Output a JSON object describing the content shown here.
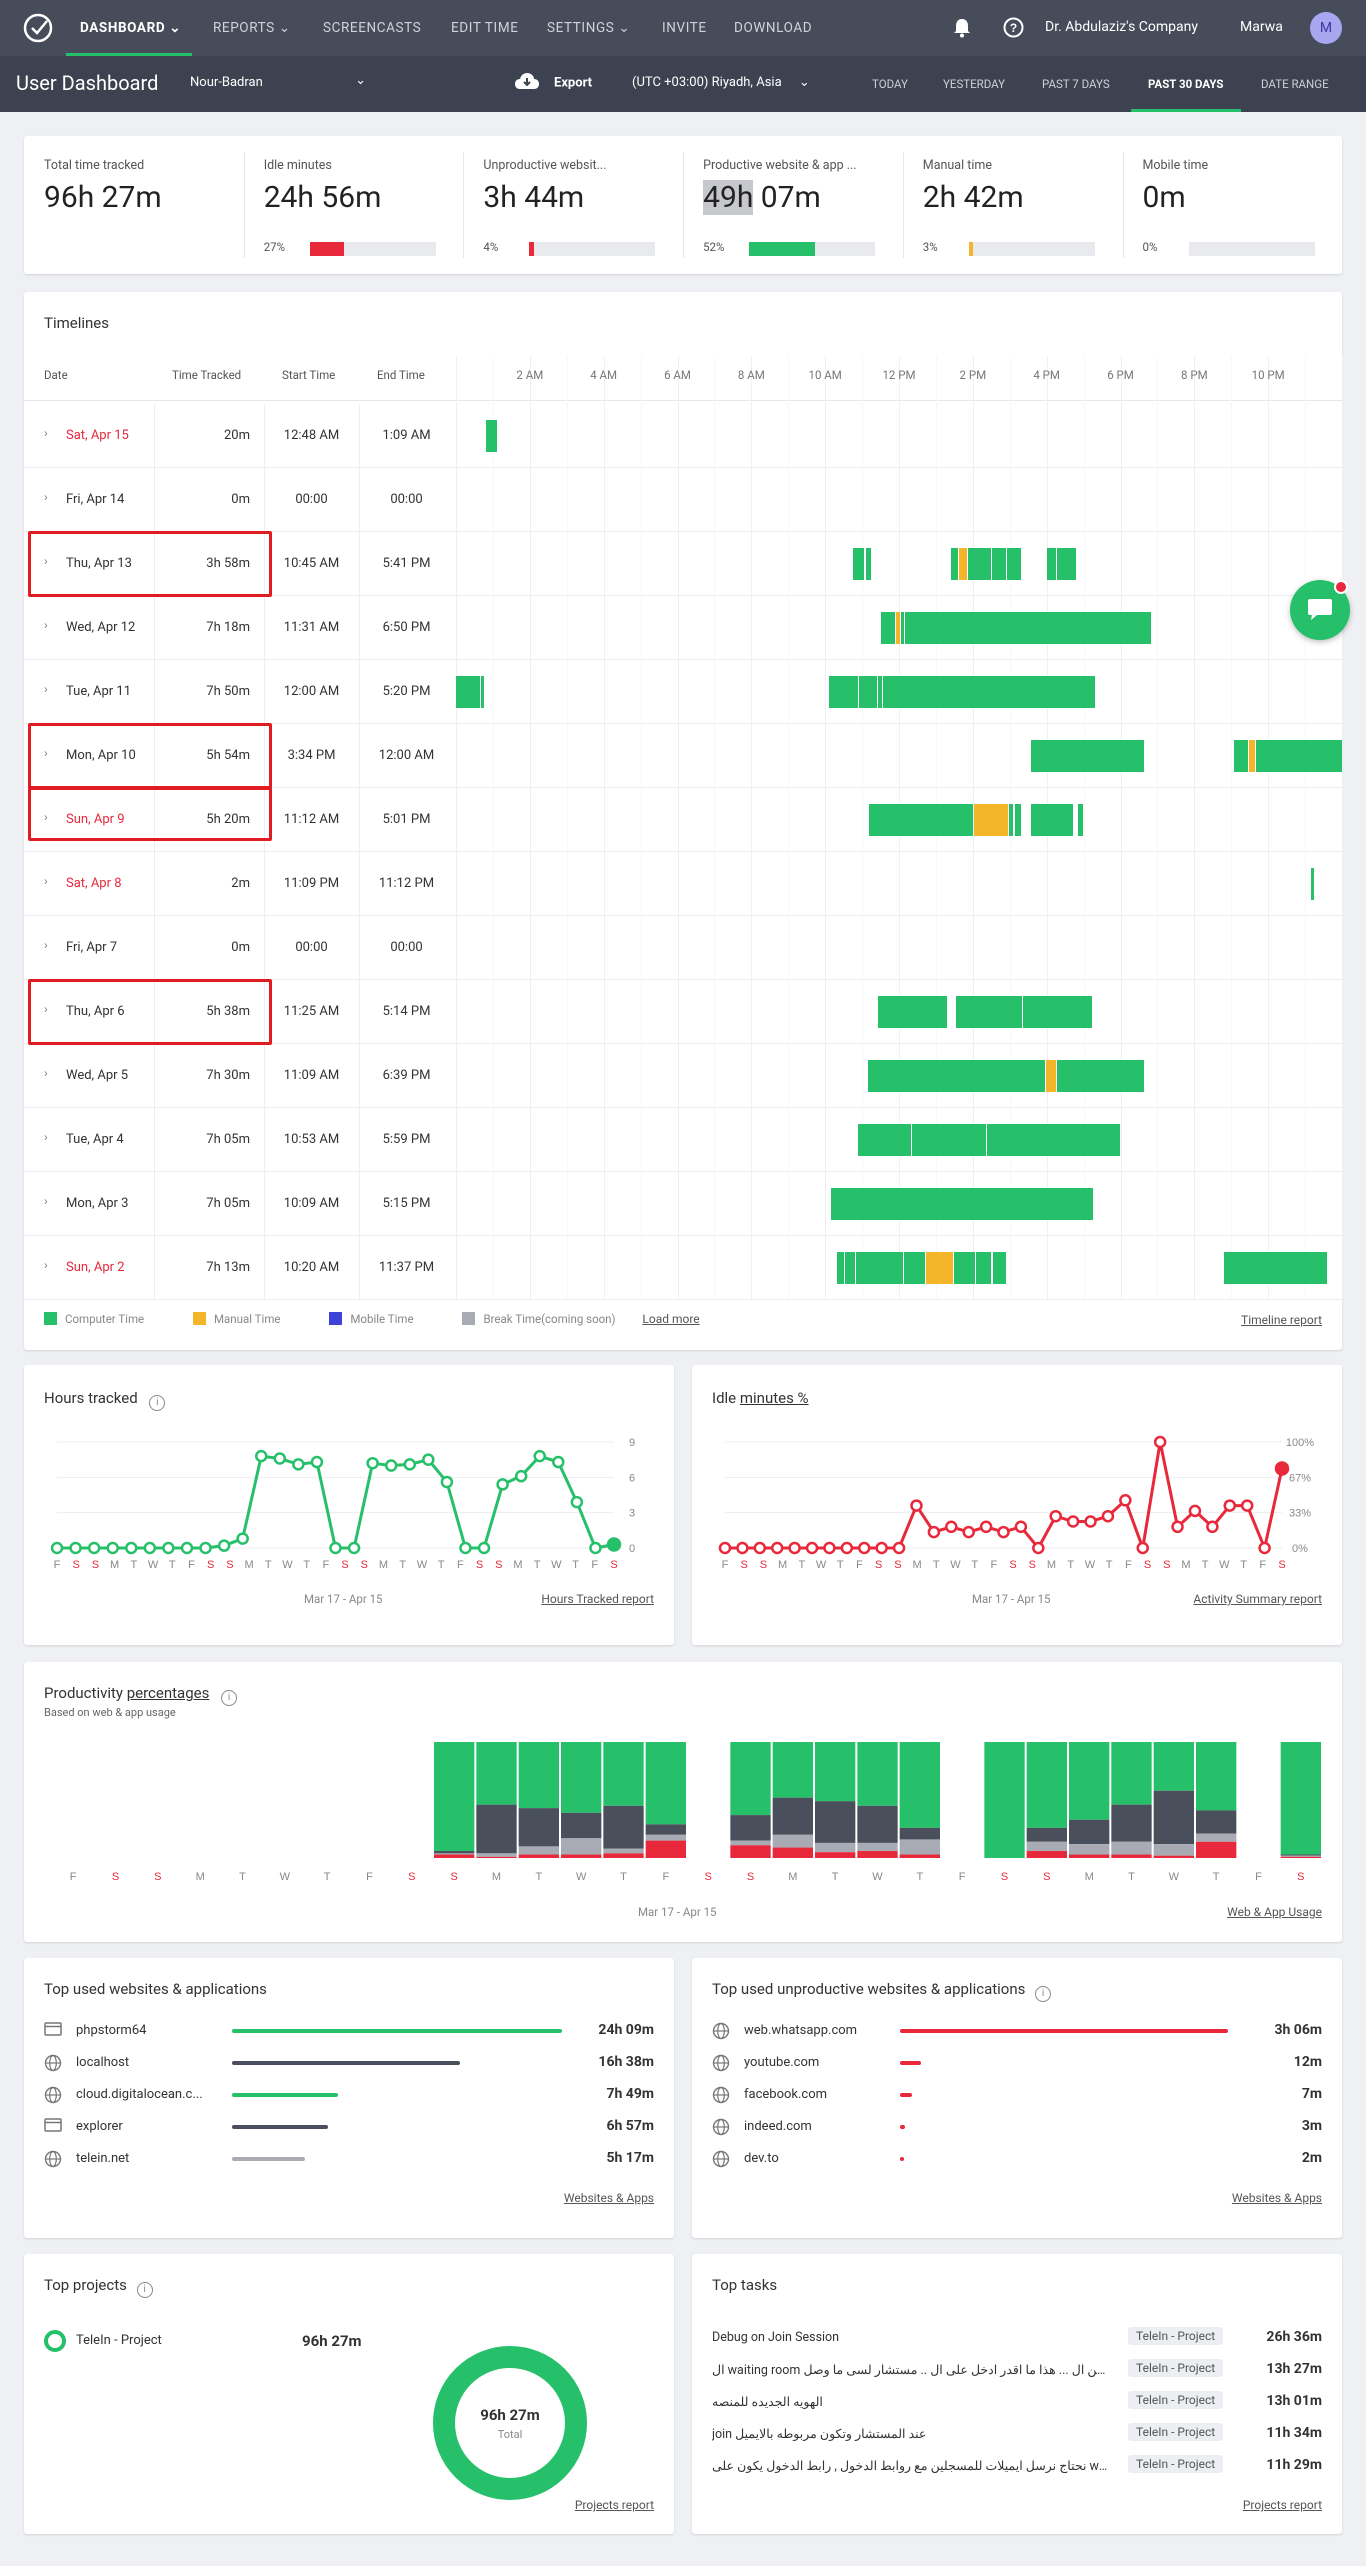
{
  "nav": {
    "dashboard": "DASHBOARD",
    "reports": "REPORTS",
    "screencasts": "SCREENCASTS",
    "edit_time": "EDIT TIME",
    "settings": "SETTINGS",
    "invite": "INVITE",
    "download": "DOWNLOAD",
    "company": "Dr. Abdulaziz's Company",
    "user": "Marwa",
    "avatar_initial": "M"
  },
  "header": {
    "title": "User Dashboard",
    "selected_user": "Nour-Badran",
    "export": "Export",
    "timezone": "(UTC +03:00) Riyadh, Asia",
    "ranges": [
      "TODAY",
      "YESTERDAY",
      "PAST 7 DAYS",
      "PAST 30 DAYS",
      "DATE RANGE"
    ],
    "active_range": "PAST 30 DAYS"
  },
  "stats": [
    {
      "label": "Total time tracked",
      "value": "96h 27m"
    },
    {
      "label": "Idle minutes",
      "value": "24h 56m",
      "pct": "27%",
      "fill": 0.27,
      "color": "#e8283b"
    },
    {
      "label": "Unproductive websit...",
      "value": "3h 44m",
      "pct": "4%",
      "fill": 0.04,
      "color": "#e8283b"
    },
    {
      "label": "Productive website & app ...",
      "value_hl": "49h",
      "value_rest": " 07m",
      "pct": "52%",
      "fill": 0.52,
      "color": "#27c06a"
    },
    {
      "label": "Manual time",
      "value": "2h 42m",
      "pct": "3%",
      "fill": 0.03,
      "color": "#f5b52a"
    },
    {
      "label": "Mobile time",
      "value": "0m",
      "pct": "0%",
      "fill": 0,
      "color": "#27c06a"
    }
  ],
  "timelines": {
    "title": "Timelines",
    "headers": {
      "date": "Date",
      "tracked": "Time Tracked",
      "start": "Start Time",
      "end": "End Time"
    },
    "hours": [
      "2 AM",
      "4 AM",
      "6 AM",
      "8 AM",
      "10 AM",
      "12 PM",
      "2 PM",
      "4 PM",
      "6 PM",
      "8 PM",
      "10 PM"
    ],
    "rows": [
      {
        "date": "Sat, Apr 15",
        "tracked": "20m",
        "start": "12:48 AM",
        "end": "1:09 AM",
        "weekend": true,
        "segs": [
          [
            0.8,
            1.1,
            "c"
          ]
        ]
      },
      {
        "date": "Fri, Apr 14",
        "tracked": "0m",
        "start": "00:00",
        "end": "00:00",
        "weekend": false,
        "segs": []
      },
      {
        "date": "Thu, Apr 13",
        "tracked": "3h 58m",
        "start": "10:45 AM",
        "end": "5:41 PM",
        "weekend": false,
        "boxed": true,
        "segs": [
          [
            10.75,
            11.05,
            "c"
          ],
          [
            11.1,
            11.25,
            "c"
          ],
          [
            13.4,
            13.6,
            "c"
          ],
          [
            13.62,
            13.85,
            "m"
          ],
          [
            13.87,
            14.5,
            "c"
          ],
          [
            14.53,
            14.9,
            "c"
          ],
          [
            14.92,
            15.3,
            "c"
          ],
          [
            16.0,
            16.25,
            "c"
          ],
          [
            16.27,
            16.8,
            "c"
          ]
        ]
      },
      {
        "date": "Wed, Apr 12",
        "tracked": "7h 18m",
        "start": "11:31 AM",
        "end": "6:50 PM",
        "weekend": false,
        "segs": [
          [
            11.52,
            11.9,
            "c"
          ],
          [
            11.92,
            12.02,
            "m"
          ],
          [
            12.05,
            12.12,
            "c"
          ],
          [
            12.15,
            18.83,
            "c"
          ]
        ]
      },
      {
        "date": "Tue, Apr 11",
        "tracked": "7h 50m",
        "start": "12:00 AM",
        "end": "5:20 PM",
        "weekend": false,
        "segs": [
          [
            0.0,
            0.65,
            "c"
          ],
          [
            0.68,
            0.75,
            "c"
          ],
          [
            10.1,
            10.9,
            "c"
          ],
          [
            10.93,
            11.4,
            "c"
          ],
          [
            11.43,
            11.55,
            "c"
          ],
          [
            11.58,
            17.3,
            "c"
          ]
        ]
      },
      {
        "date": "Mon, Apr 10",
        "tracked": "5h 54m",
        "start": "3:34 PM",
        "end": "12:00 AM",
        "weekend": false,
        "boxed": true,
        "segs": [
          [
            15.57,
            18.65,
            "c"
          ],
          [
            21.07,
            21.45,
            "c"
          ],
          [
            21.48,
            21.65,
            "m"
          ],
          [
            21.68,
            21.88,
            "c"
          ],
          [
            21.9,
            24.0,
            "c"
          ]
        ]
      },
      {
        "date": "Sun, Apr 9",
        "tracked": "5h 20m",
        "start": "11:12 AM",
        "end": "5:01 PM",
        "weekend": true,
        "boxed": true,
        "segs": [
          [
            11.2,
            14.0,
            "c"
          ],
          [
            14.02,
            14.95,
            "m"
          ],
          [
            14.98,
            15.1,
            "c"
          ],
          [
            15.13,
            15.3,
            "c"
          ],
          [
            15.58,
            16.7,
            "c"
          ],
          [
            16.85,
            16.98,
            "c"
          ]
        ]
      },
      {
        "date": "Sat, Apr 8",
        "tracked": "2m",
        "start": "11:09 PM",
        "end": "11:12 PM",
        "weekend": true,
        "segs": [
          [
            23.15,
            23.22,
            "c"
          ]
        ]
      },
      {
        "date": "Fri, Apr 7",
        "tracked": "0m",
        "start": "00:00",
        "end": "00:00",
        "weekend": false,
        "segs": []
      },
      {
        "date": "Thu, Apr 6",
        "tracked": "5h 38m",
        "start": "11:25 AM",
        "end": "5:14 PM",
        "weekend": false,
        "boxed": true,
        "segs": [
          [
            11.42,
            13.3,
            "c"
          ],
          [
            13.55,
            15.32,
            "c"
          ],
          [
            15.35,
            17.23,
            "c"
          ]
        ]
      },
      {
        "date": "Wed, Apr 5",
        "tracked": "7h 30m",
        "start": "11:09 AM",
        "end": "6:39 PM",
        "weekend": false,
        "segs": [
          [
            11.15,
            15.95,
            "c"
          ],
          [
            15.98,
            16.25,
            "m"
          ],
          [
            16.27,
            18.65,
            "c"
          ]
        ]
      },
      {
        "date": "Tue, Apr 4",
        "tracked": "7h 05m",
        "start": "10:53 AM",
        "end": "5:59 PM",
        "weekend": false,
        "segs": [
          [
            10.88,
            12.32,
            "c"
          ],
          [
            12.35,
            14.35,
            "c"
          ],
          [
            14.38,
            17.98,
            "c"
          ]
        ]
      },
      {
        "date": "Mon, Apr 3",
        "tracked": "7h 05m",
        "start": "10:09 AM",
        "end": "5:15 PM",
        "weekend": false,
        "segs": [
          [
            10.15,
            17.25,
            "c"
          ]
        ]
      },
      {
        "date": "Sun, Apr 2",
        "tracked": "7h 13m",
        "start": "10:20 AM",
        "end": "11:37 PM",
        "weekend": true,
        "segs": [
          [
            10.33,
            10.5,
            "c"
          ],
          [
            10.55,
            10.8,
            "c"
          ],
          [
            10.83,
            12.1,
            "c"
          ],
          [
            12.13,
            12.7,
            "c"
          ],
          [
            12.73,
            13.45,
            "m"
          ],
          [
            13.48,
            14.05,
            "c"
          ],
          [
            14.08,
            14.5,
            "c"
          ],
          [
            14.55,
            14.9,
            "c"
          ],
          [
            20.8,
            23.6,
            "c"
          ]
        ]
      }
    ],
    "legend": [
      "Computer Time",
      "Manual Time",
      "Mobile Time",
      "Break Time(coming soon)"
    ],
    "load_more": "Load more",
    "report_link": "Timeline report"
  },
  "hours_chart": {
    "title": "Hours tracked",
    "range": "Mar 17 - Apr 15",
    "link": "Hours Tracked report"
  },
  "idle_chart": {
    "title": "Idle ",
    "title_ul": "minutes %",
    "range": "Mar 17 - Apr 15",
    "link": "Activity Summary report"
  },
  "productivity": {
    "title": "Productivity ",
    "title_ul": "percentages",
    "subtitle": "Based on web & app usage",
    "range": "Mar 17 - Apr 15",
    "link": "Web & App Usage"
  },
  "chart_data": [
    {
      "type": "line",
      "name": "Hours tracked",
      "categories": [
        "F",
        "S",
        "S",
        "M",
        "T",
        "W",
        "T",
        "F",
        "S",
        "S",
        "M",
        "T",
        "W",
        "T",
        "F",
        "S",
        "S",
        "M",
        "T",
        "W",
        "T",
        "F",
        "S",
        "S",
        "M",
        "T",
        "W",
        "T",
        "F",
        "S"
      ],
      "values": [
        0,
        0,
        0,
        0,
        0,
        0,
        0,
        0,
        0,
        0.2,
        0.8,
        7.8,
        7.6,
        7.1,
        7.3,
        0,
        0,
        7.2,
        7.0,
        7.1,
        7.5,
        5.6,
        0,
        0,
        5.4,
        6.1,
        7.8,
        7.3,
        3.9,
        0,
        0.3
      ],
      "ylim": [
        0,
        9
      ],
      "yticks": [
        0,
        3,
        6,
        9
      ],
      "color": "#27c06a"
    },
    {
      "type": "line",
      "name": "Idle minutes %",
      "categories": [
        "F",
        "S",
        "S",
        "M",
        "T",
        "W",
        "T",
        "F",
        "S",
        "S",
        "M",
        "T",
        "W",
        "T",
        "F",
        "S",
        "S",
        "M",
        "T",
        "W",
        "T",
        "F",
        "S",
        "S",
        "M",
        "T",
        "W",
        "T",
        "F",
        "S"
      ],
      "values": [
        0,
        0,
        0,
        0,
        0,
        0,
        0,
        0,
        0,
        0,
        0,
        40,
        15,
        20,
        15,
        20,
        15,
        20,
        0,
        30,
        25,
        25,
        30,
        45,
        0,
        100,
        20,
        35,
        20,
        40,
        40,
        0,
        75
      ],
      "ylim": [
        0,
        100
      ],
      "yticks": [
        "0%",
        "33%",
        "67%",
        "100%"
      ],
      "color": "#e8283b"
    },
    {
      "type": "bar",
      "name": "Productivity percentages",
      "categories": [
        "F",
        "S",
        "S",
        "M",
        "T",
        "W",
        "T",
        "F",
        "S",
        "S",
        "M",
        "T",
        "W",
        "T",
        "F",
        "S",
        "S",
        "M",
        "T",
        "W",
        "T",
        "F",
        "S",
        "S",
        "M",
        "T",
        "W",
        "T",
        "F",
        "S"
      ],
      "series_names": [
        "productive",
        "neutral",
        "unproductive-grey",
        "unproductive"
      ],
      "stacks": [
        [
          0,
          0,
          0,
          0
        ],
        [
          0,
          0,
          0,
          0
        ],
        [
          0,
          0,
          0,
          0
        ],
        [
          0,
          0,
          0,
          0
        ],
        [
          0,
          0,
          0,
          0
        ],
        [
          0,
          0,
          0,
          0
        ],
        [
          0,
          0,
          0,
          0
        ],
        [
          0,
          0,
          0,
          0
        ],
        [
          0,
          0,
          0,
          0
        ],
        [
          94,
          2,
          1,
          3
        ],
        [
          54,
          42,
          3,
          1
        ],
        [
          57,
          33,
          7,
          3
        ],
        [
          61,
          22,
          14,
          3
        ],
        [
          55,
          37,
          4,
          4
        ],
        [
          71,
          9,
          5,
          15
        ],
        [
          0,
          0,
          0,
          0
        ],
        [
          63,
          22,
          4,
          11
        ],
        [
          48,
          32,
          11,
          9
        ],
        [
          51,
          36,
          8,
          5
        ],
        [
          55,
          32,
          7,
          6
        ],
        [
          74,
          10,
          13,
          3
        ],
        [
          0,
          0,
          0,
          0
        ],
        [
          100,
          0,
          0,
          0
        ],
        [
          74,
          12,
          8,
          6
        ],
        [
          67,
          21,
          9,
          3
        ],
        [
          54,
          32,
          11,
          3
        ],
        [
          42,
          46,
          10,
          2
        ],
        [
          59,
          20,
          7,
          14
        ],
        [
          0,
          0,
          0,
          0
        ],
        [
          97,
          1,
          1,
          1
        ]
      ]
    }
  ],
  "top_sites": {
    "title": "Top used websites & applications",
    "items": [
      {
        "name": "phpstorm64",
        "value": "24h 09m",
        "bar": 1.0,
        "color": "#27c06a",
        "icon": "window"
      },
      {
        "name": "localhost",
        "value": "16h 38m",
        "bar": 0.69,
        "color": "#4a4f5c",
        "icon": "globe"
      },
      {
        "name": "cloud.digitalocean.c...",
        "value": "7h 49m",
        "bar": 0.32,
        "color": "#27c06a",
        "icon": "globe"
      },
      {
        "name": "explorer",
        "value": "6h 57m",
        "bar": 0.29,
        "color": "#4a4f5c",
        "icon": "window"
      },
      {
        "name": "telein.net",
        "value": "5h 17m",
        "bar": 0.22,
        "color": "#a8abb3",
        "icon": "globe"
      }
    ],
    "link": "Websites & Apps"
  },
  "top_unprod": {
    "title": "Top used unproductive websites & applications",
    "items": [
      {
        "name": "web.whatsapp.com",
        "value": "3h 06m",
        "bar": 1.0
      },
      {
        "name": "youtube.com",
        "value": "12m",
        "bar": 0.065
      },
      {
        "name": "facebook.com",
        "value": "7m",
        "bar": 0.038
      },
      {
        "name": "indeed.com",
        "value": "3m",
        "bar": 0.016
      },
      {
        "name": "dev.to",
        "value": "2m",
        "bar": 0.011
      }
    ],
    "link": "Websites & Apps"
  },
  "top_projects": {
    "title": "Top projects",
    "items": [
      {
        "name": "TeleIn - Project",
        "value": "96h 27m"
      }
    ],
    "donut_value": "96h 27m",
    "donut_label": "Total",
    "link": "Projects report"
  },
  "top_tasks": {
    "title": "Top tasks",
    "items": [
      {
        "name": "Debug on Join Session",
        "project": "TeleIn - Project",
        "value": "26h 36m"
      },
      {
        "name": "ال waiting room ما اطلع من ال ... هذا ما اقدر ادخل على ال .. مستشار لسى ما وصل",
        "project": "TeleIn - Project",
        "value": "13h 27m"
      },
      {
        "name": "الهويه الجديده للمنصه",
        "project": "TeleIn - Project",
        "value": "13h 01m"
      },
      {
        "name": "join عند المستشار وتكون مربوطه بالايميل",
        "project": "TeleIn - Project",
        "value": "11h 34m"
      },
      {
        "name": "نحتاج نرسل ايميلات للمسجلين مع روابط الدخول , رابط الدخول يكون على waiti...",
        "project": "TeleIn - Project",
        "value": "11h 29m"
      }
    ],
    "link": "Projects report"
  }
}
